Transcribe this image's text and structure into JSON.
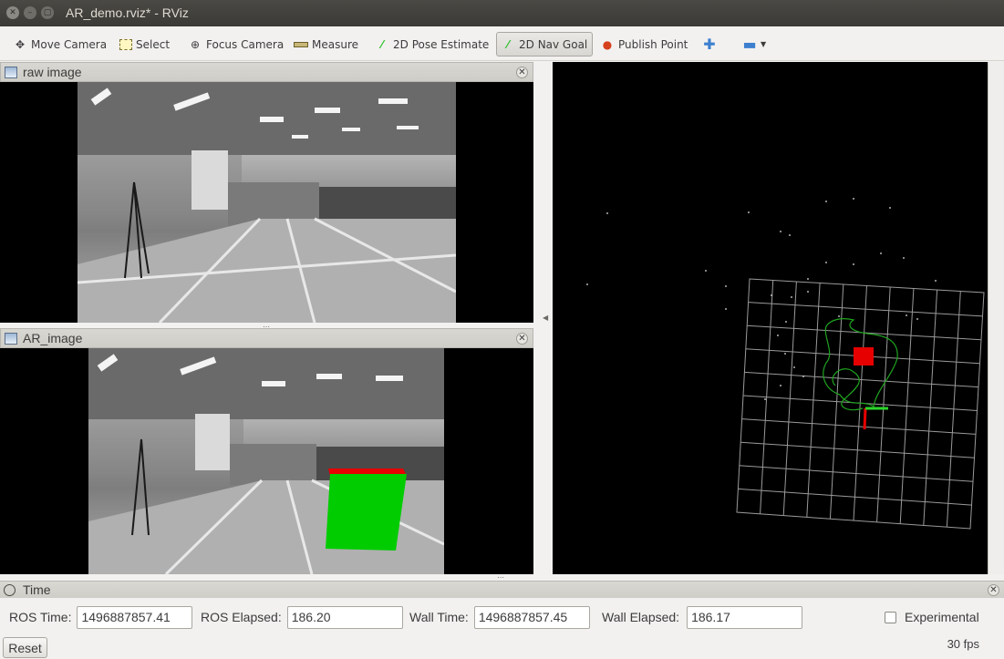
{
  "window": {
    "title": "AR_demo.rviz* - RViz"
  },
  "toolbar": {
    "items": [
      {
        "label": "Move Camera",
        "icon": "move-camera-icon"
      },
      {
        "label": "Select",
        "icon": "select-icon"
      },
      {
        "label": "Focus Camera",
        "icon": "focus-camera-icon"
      },
      {
        "label": "Measure",
        "icon": "measure-icon"
      },
      {
        "label": "2D Pose Estimate",
        "icon": "pose-estimate-icon"
      },
      {
        "label": "2D Nav Goal",
        "icon": "nav-goal-icon",
        "active": true
      },
      {
        "label": "Publish Point",
        "icon": "publish-point-icon"
      }
    ],
    "add_icon": "plus-icon",
    "remove_icon": "minus-icon"
  },
  "panels": {
    "raw_image": {
      "title": "raw image"
    },
    "ar_image": {
      "title": "AR_image"
    }
  },
  "time_panel": {
    "title": "Time",
    "ros_time_label": "ROS Time:",
    "ros_time": "1496887857.41",
    "ros_elapsed_label": "ROS Elapsed:",
    "ros_elapsed": "186.20",
    "wall_time_label": "Wall Time:",
    "wall_time": "1496887857.45",
    "wall_elapsed_label": "Wall Elapsed:",
    "wall_elapsed": "186.17",
    "experimental_label": "Experimental",
    "experimental_checked": false
  },
  "status": {
    "reset_label": "Reset",
    "fps": "30 fps"
  },
  "colors": {
    "ar_cube": "#00cc00",
    "ar_cube_top": "#e60000",
    "trajectory": "#1fa31f",
    "grid": "#9a9a9a",
    "marker": "#e60000"
  }
}
